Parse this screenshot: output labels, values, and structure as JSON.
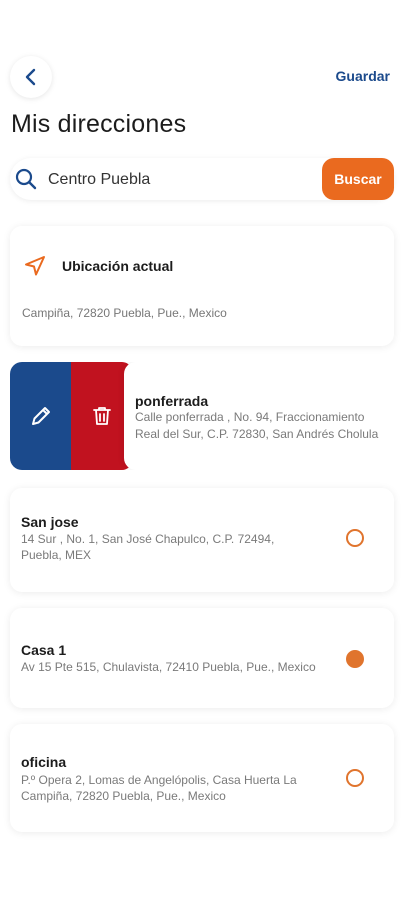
{
  "header": {
    "back_icon": "chevron-left-icon",
    "save_label": "Guardar",
    "title": "Mis direcciones"
  },
  "search": {
    "value": "Centro Puebla",
    "placeholder": "Centro Puebla",
    "button_label": "Buscar",
    "icon": "search-icon"
  },
  "current_location": {
    "label": "Ubicación actual",
    "icon": "navigation-arrow-icon",
    "peek_text": "Campiña, 72820 Puebla, Pue., Mexico"
  },
  "swiped_address": {
    "name": "ponferrada",
    "line1": "Calle ponferrada , No. 94, Fraccionamiento",
    "line2": "Real del Sur, C.P. 72830, San Andrés Cholula",
    "edit_icon": "pencil-icon",
    "delete_icon": "trash-icon"
  },
  "addresses": [
    {
      "name": "San jose",
      "line1": "14 Sur , No. 1, San José Chapulco, C.P. 72494,",
      "line2": "Puebla, MEX",
      "selected": false
    },
    {
      "name": "Casa 1",
      "line1": "Av 15 Pte 515, Chulavista, 72410 Puebla, Pue., Mexico",
      "line2": "",
      "selected": true
    },
    {
      "name": "oficina",
      "line1": "P.º Opera 2, Lomas de Angelópolis, Casa Huerta La",
      "line2": "Campiña, 72820 Puebla, Pue., Mexico",
      "selected": false
    }
  ],
  "colors": {
    "accent_orange": "#ea6a1f",
    "brand_blue": "#1b4a8c",
    "delete_red": "#c1121f"
  }
}
